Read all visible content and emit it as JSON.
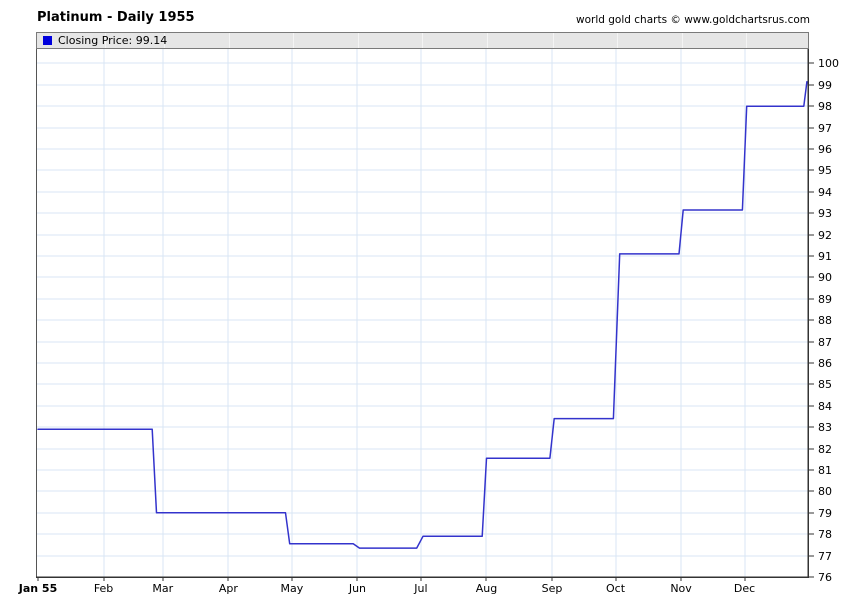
{
  "header": {
    "title": "Platinum - Daily 1955",
    "credit": "world gold charts © www.goldchartsrus.com"
  },
  "legend": {
    "label": "Closing Price: 99.14",
    "swatch_color": "#0000dd"
  },
  "colors": {
    "line": "#3333cc",
    "grid": "#d9e6f4",
    "axis": "#333333",
    "plot_left_border": "#555555",
    "legend_bg": "#e6e6e6",
    "legend_border": "#7a7a7a"
  },
  "chart_data": {
    "type": "line",
    "title": "Platinum - Daily 1955",
    "series_name": "Closing Price",
    "last_value": 99.14,
    "ylabel": "",
    "xlabel": "",
    "ylim": [
      76,
      100
    ],
    "grid": true,
    "legend_position": "top-left",
    "y_ticks": [
      76,
      77,
      78,
      79,
      80,
      81,
      82,
      83,
      84,
      85,
      86,
      87,
      88,
      89,
      90,
      91,
      92,
      93,
      94,
      95,
      96,
      97,
      98,
      99,
      100
    ],
    "x_range_days": [
      0,
      364
    ],
    "x_ticks": [
      {
        "label": "Jan 55",
        "day": 0,
        "bold": true
      },
      {
        "label": "Feb",
        "day": 31,
        "bold": false
      },
      {
        "label": "Mar",
        "day": 59,
        "bold": false
      },
      {
        "label": "Apr",
        "day": 90,
        "bold": false
      },
      {
        "label": "May",
        "day": 120,
        "bold": false
      },
      {
        "label": "Jun",
        "day": 151,
        "bold": false
      },
      {
        "label": "Jul",
        "day": 181,
        "bold": false
      },
      {
        "label": "Aug",
        "day": 212,
        "bold": false
      },
      {
        "label": "Sep",
        "day": 243,
        "bold": false
      },
      {
        "label": "Oct",
        "day": 273,
        "bold": false
      },
      {
        "label": "Nov",
        "day": 304,
        "bold": false
      },
      {
        "label": "Dec",
        "day": 334,
        "bold": false
      }
    ],
    "points": [
      [
        0,
        82.9
      ],
      [
        54,
        82.9
      ],
      [
        56,
        79.0
      ],
      [
        117,
        79.0
      ],
      [
        119,
        77.55
      ],
      [
        149,
        77.55
      ],
      [
        152,
        77.35
      ],
      [
        179,
        77.35
      ],
      [
        182,
        77.9
      ],
      [
        210,
        77.9
      ],
      [
        212,
        81.55
      ],
      [
        242,
        81.55
      ],
      [
        244,
        83.4
      ],
      [
        272,
        83.4
      ],
      [
        275,
        91.1
      ],
      [
        303,
        91.1
      ],
      [
        305,
        93.15
      ],
      [
        333,
        93.15
      ],
      [
        335,
        98.0
      ],
      [
        362,
        98.0
      ],
      [
        363.5,
        99.14
      ]
    ]
  }
}
